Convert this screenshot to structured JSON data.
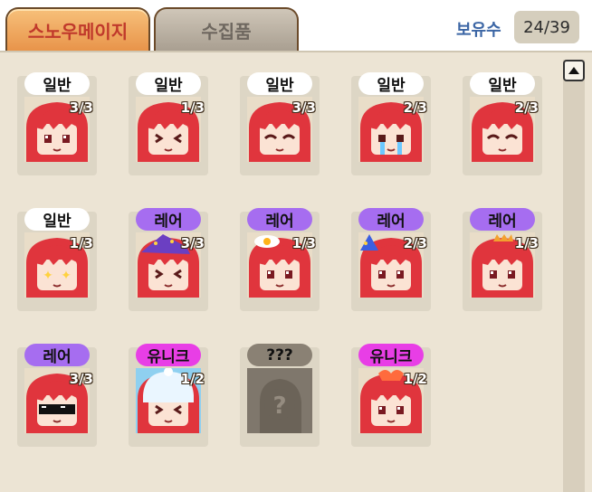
{
  "tabs": [
    {
      "label": "스노우메이지",
      "active": true
    },
    {
      "label": "수집품",
      "active": false
    }
  ],
  "ownership": {
    "label": "보유수",
    "value": "24/39"
  },
  "cards": [
    {
      "rarity": "일반",
      "tier": "common",
      "count": "3/3",
      "accessory": "none",
      "expression": "smile"
    },
    {
      "rarity": "일반",
      "tier": "common",
      "count": "1/3",
      "accessory": "none",
      "expression": "laugh"
    },
    {
      "rarity": "일반",
      "tier": "common",
      "count": "3/3",
      "accessory": "none",
      "expression": "wink"
    },
    {
      "rarity": "일반",
      "tier": "common",
      "count": "2/3",
      "accessory": "none",
      "expression": "cry"
    },
    {
      "rarity": "일반",
      "tier": "common",
      "count": "2/3",
      "accessory": "none",
      "expression": "content"
    },
    {
      "rarity": "일반",
      "tier": "common",
      "count": "1/3",
      "accessory": "none",
      "expression": "star-eyes"
    },
    {
      "rarity": "레어",
      "tier": "rare",
      "count": "3/3",
      "accessory": "wizard-hat",
      "expression": "laugh"
    },
    {
      "rarity": "레어",
      "tier": "rare",
      "count": "1/3",
      "accessory": "fried-egg",
      "expression": "smile"
    },
    {
      "rarity": "레어",
      "tier": "rare",
      "count": "2/3",
      "accessory": "party-hat",
      "expression": "neutral"
    },
    {
      "rarity": "레어",
      "tier": "rare",
      "count": "1/3",
      "accessory": "crown",
      "expression": "smile"
    },
    {
      "rarity": "레어",
      "tier": "rare",
      "count": "3/3",
      "accessory": "sunglasses",
      "expression": "smile"
    },
    {
      "rarity": "유니크",
      "tier": "unique",
      "count": "1/2",
      "accessory": "snow-hood",
      "expression": "squint"
    },
    {
      "rarity": "???",
      "tier": "unknown",
      "count": "",
      "accessory": "locked",
      "expression": "none"
    },
    {
      "rarity": "유니크",
      "tier": "unique",
      "count": "1/2",
      "accessory": "flame-hair",
      "expression": "neutral"
    }
  ],
  "colors": {
    "panel": "#ece4d4",
    "common": "#ffffff",
    "rare": "#a66df0",
    "unique": "#e83ee6",
    "unknown": "#8a8174",
    "hair": "#e0353d"
  }
}
